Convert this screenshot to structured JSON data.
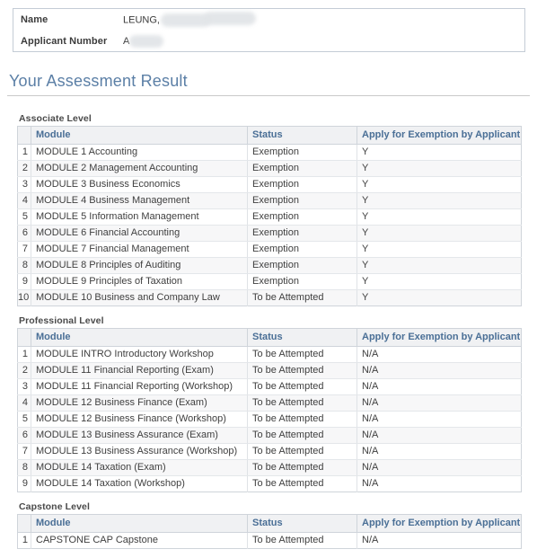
{
  "applicant": {
    "name_label": "Name",
    "name_value": "LEUNG,",
    "number_label": "Applicant Number",
    "number_value": "A"
  },
  "page": {
    "title": "Your Assessment Result"
  },
  "columns": {
    "module": "Module",
    "status": "Status",
    "apply": "Apply for Exemption by Applicant"
  },
  "levels": [
    {
      "title": "Associate Level",
      "rows": [
        {
          "no": "1",
          "module": "MODULE 1 Accounting",
          "status": "Exemption",
          "apply": "Y"
        },
        {
          "no": "2",
          "module": "MODULE 2 Management Accounting",
          "status": "Exemption",
          "apply": "Y"
        },
        {
          "no": "3",
          "module": "MODULE 3 Business Economics",
          "status": "Exemption",
          "apply": "Y"
        },
        {
          "no": "4",
          "module": "MODULE 4 Business Management",
          "status": "Exemption",
          "apply": "Y"
        },
        {
          "no": "5",
          "module": "MODULE 5 Information Management",
          "status": "Exemption",
          "apply": "Y"
        },
        {
          "no": "6",
          "module": "MODULE 6 Financial Accounting",
          "status": "Exemption",
          "apply": "Y"
        },
        {
          "no": "7",
          "module": "MODULE 7 Financial Management",
          "status": "Exemption",
          "apply": "Y"
        },
        {
          "no": "8",
          "module": "MODULE 8 Principles of Auditing",
          "status": "Exemption",
          "apply": "Y"
        },
        {
          "no": "9",
          "module": "MODULE 9 Principles of Taxation",
          "status": "Exemption",
          "apply": "Y"
        },
        {
          "no": "10",
          "module": "MODULE 10 Business and Company Law",
          "status": "To be Attempted",
          "apply": "Y"
        }
      ]
    },
    {
      "title": "Professional Level",
      "rows": [
        {
          "no": "1",
          "module": "MODULE INTRO Introductory Workshop",
          "status": "To be Attempted",
          "apply": "N/A"
        },
        {
          "no": "2",
          "module": "MODULE 11 Financial Reporting (Exam)",
          "status": "To be Attempted",
          "apply": "N/A"
        },
        {
          "no": "3",
          "module": "MODULE 11 Financial Reporting (Workshop)",
          "status": "To be Attempted",
          "apply": "N/A"
        },
        {
          "no": "4",
          "module": "MODULE 12 Business Finance (Exam)",
          "status": "To be Attempted",
          "apply": "N/A"
        },
        {
          "no": "5",
          "module": "MODULE 12 Business Finance (Workshop)",
          "status": "To be Attempted",
          "apply": "N/A"
        },
        {
          "no": "6",
          "module": "MODULE 13 Business Assurance (Exam)",
          "status": "To be Attempted",
          "apply": "N/A"
        },
        {
          "no": "7",
          "module": "MODULE 13 Business Assurance (Workshop)",
          "status": "To be Attempted",
          "apply": "N/A"
        },
        {
          "no": "8",
          "module": "MODULE 14 Taxation (Exam)",
          "status": "To be Attempted",
          "apply": "N/A"
        },
        {
          "no": "9",
          "module": "MODULE 14 Taxation (Workshop)",
          "status": "To be Attempted",
          "apply": "N/A"
        }
      ]
    },
    {
      "title": "Capstone Level",
      "rows": [
        {
          "no": "1",
          "module": "CAPSTONE CAP Capstone",
          "status": "To be Attempted",
          "apply": "N/A"
        }
      ]
    }
  ],
  "colors": {
    "title_blue": "#5b7fa6",
    "header_text": "#4a6f96",
    "header_bg": "#f0f1f3",
    "border": "#cfd4da",
    "stripe": "#f7f7f8"
  }
}
